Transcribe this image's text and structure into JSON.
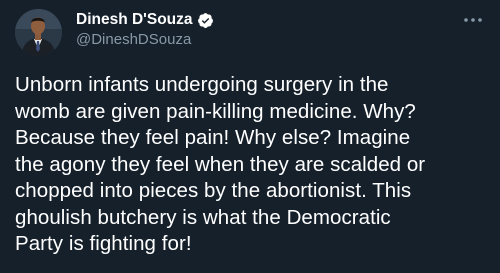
{
  "author": {
    "display_name": "Dinesh D'Souza",
    "handle": "@DineshDSouza",
    "verified": true,
    "avatar_icon": "profile-photo"
  },
  "more_icon": "more-horizontal-icon",
  "tweet": {
    "lines": [
      "Unborn infants undergoing surgery in the",
      "womb are given pain-killing medicine. Why?",
      "Because they feel pain! Why else? Imagine",
      "the agony they feel when they are scalded or",
      "chopped into pieces by the abortionist. This",
      "ghoulish butchery is what the Democratic",
      "Party is fighting for!"
    ]
  },
  "colors": {
    "background": "#15202b",
    "text_primary": "#ffffff",
    "text_secondary": "#8899a6",
    "verified_badge": "#ffffff"
  }
}
